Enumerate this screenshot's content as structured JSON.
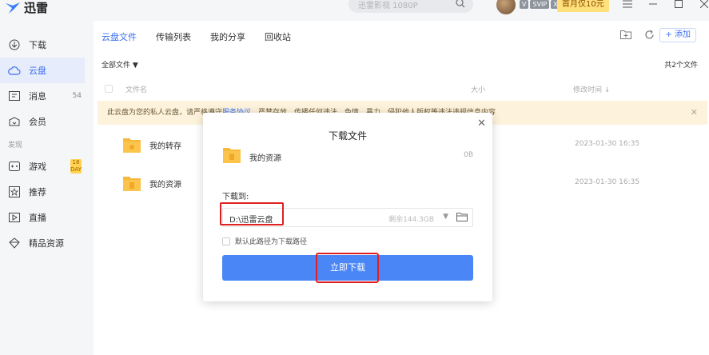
{
  "app": {
    "name": "迅雷"
  },
  "header": {
    "search_placeholder": "迅雷影视 1080P",
    "vip_badges": [
      "V",
      "SVIP",
      "X"
    ],
    "promo": "首月仅10元"
  },
  "sidebar": {
    "items": [
      {
        "label": "下载",
        "icon": "download-icon"
      },
      {
        "label": "云盘",
        "icon": "cloud-icon",
        "active": true
      },
      {
        "label": "消息",
        "icon": "message-icon",
        "count": "54"
      },
      {
        "label": "会员",
        "icon": "vip-icon"
      }
    ],
    "section_label": "发现",
    "discover_items": [
      {
        "label": "游戏",
        "icon": "game-icon",
        "badge": "18 DAY"
      },
      {
        "label": "推荐",
        "icon": "star-icon"
      },
      {
        "label": "直播",
        "icon": "live-icon"
      },
      {
        "label": "精品资源",
        "icon": "gem-icon"
      }
    ]
  },
  "main": {
    "tabs": [
      "云盘文件",
      "传输列表",
      "我的分享",
      "回收站"
    ],
    "add_label": "+ 添加",
    "filter": "全部文件",
    "count": "共2个文件",
    "columns": {
      "name": "文件名",
      "size": "大小",
      "modified": "修改时间 ↓"
    },
    "banner": {
      "text": "此云盘为您的私人云盘，请严格遵守",
      "link": "服务协议",
      "tail": "，严禁存放、传播任何违法、色情、暴力、侵犯他人版权等违法违规信息内容"
    },
    "files": [
      {
        "name": "我的转存",
        "time": "2023-01-30 16:35"
      },
      {
        "name": "我的资源",
        "time": "2023-01-30 16:35"
      }
    ]
  },
  "modal": {
    "title": "下载文件",
    "file_name": "我的资源",
    "file_size": "0B",
    "label": "下载到:",
    "path": "D:\\迅雷云盘",
    "free_space": "剩余144.3GB",
    "default_checkbox": "默认此路径为下载路径",
    "download_button": "立即下载"
  },
  "colors": {
    "accent": "#3a6ff0",
    "button": "#4a86f6",
    "highlight": "#e02020",
    "folder": "#f7b83b"
  }
}
